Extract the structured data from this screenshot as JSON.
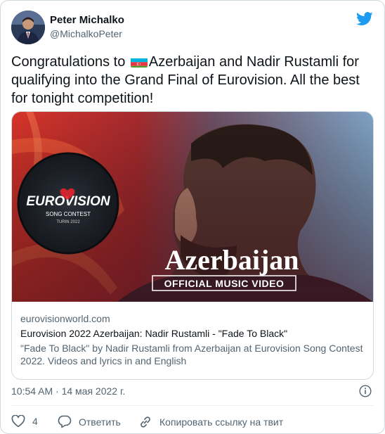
{
  "author": {
    "name": "Peter Michalko",
    "handle": "@MichalkoPeter"
  },
  "tweet": {
    "text_before_flag": "Congratulations to ",
    "flag_icon": "azerbaijan-flag-icon",
    "text_after_flag": "Azerbaijan and Nadir Rustamli for qualifying into the Grand Final of Eurovision. All the best for tonight competition!"
  },
  "link_card": {
    "thumbnail": {
      "logo_main": "EUROVISION",
      "logo_sub": "SONG CONTEST",
      "logo_city": "TURIN 2022",
      "country": "Azerbaijan",
      "banner": "OFFICIAL MUSIC VIDEO"
    },
    "domain": "eurovisionworld.com",
    "title": "Eurovision 2022 Azerbaijan: Nadir Rustamli - \"Fade To Black\"",
    "description": "\"Fade To Black\" by Nadir Rustamli from Azerbaijan at Eurovision Song Contest 2022. Videos and lyrics in and English"
  },
  "timestamp": "10:54 AM · 14 мая 2022 г.",
  "actions": {
    "like_count": "4",
    "reply_label": "Ответить",
    "copy_label": "Копировать ссылку на твит"
  },
  "colors": {
    "twitter_blue": "#1d9bf0",
    "text_secondary": "#536471",
    "eurovision_red": "#e2232f"
  }
}
